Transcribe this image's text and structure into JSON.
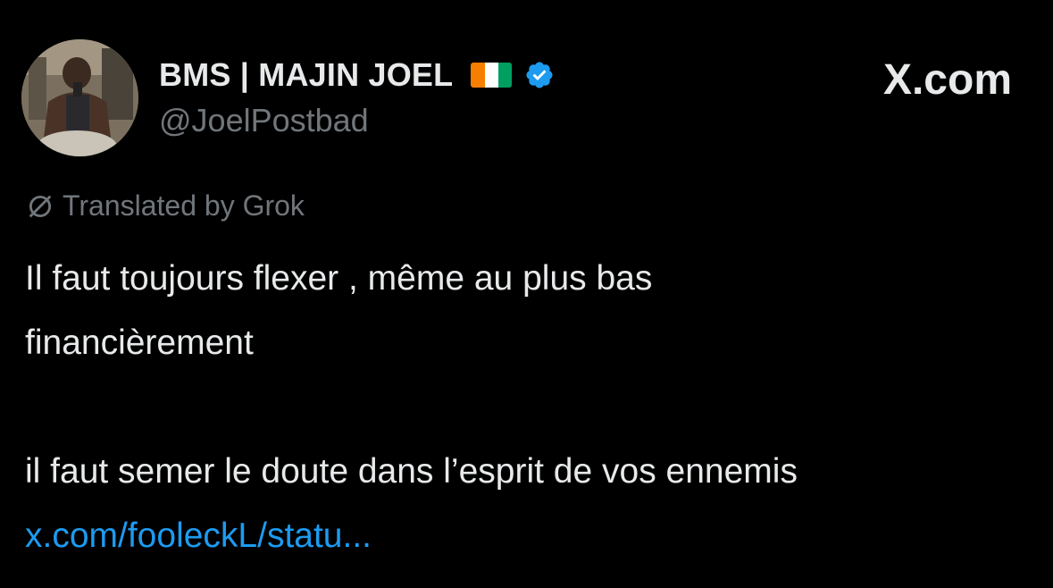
{
  "author": {
    "display_name": "BMS | MAJIN JOEL",
    "handle": "@JoelPostbad",
    "flag_icon": "cote-divoire-flag-icon",
    "verified_icon": "verified-badge-icon",
    "avatar_icon": "profile-avatar"
  },
  "site": {
    "label": "X.com"
  },
  "translation": {
    "label": "Translated by Grok",
    "icon": "grok-icon"
  },
  "tweet": {
    "lines": [
      "Il faut toujours flexer , même au plus bas",
      "financièrement",
      "",
      "il faut semer le doute dans l’esprit de vos ennemis"
    ],
    "link_text": "x.com/fooleckL/statu..."
  },
  "colors": {
    "background": "#000000",
    "primary_text": "#e7e9ea",
    "secondary_text": "#71767b",
    "link": "#1d9bf0",
    "verified": "#1d9bf0",
    "flag_orange": "#f77f00",
    "flag_white": "#ffffff",
    "flag_green": "#009e60"
  }
}
